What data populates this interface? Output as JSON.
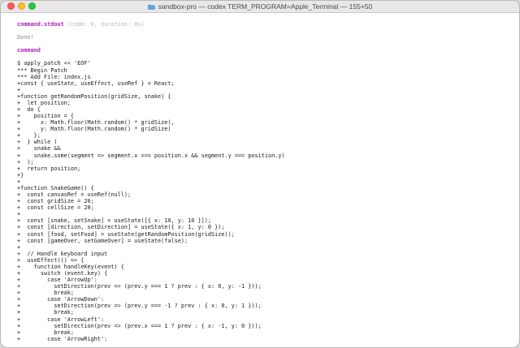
{
  "window": {
    "title": "sandbox-pro — codex TERM_PROGRAM=Apple_Terminal — 155×50",
    "folder_icon": "folder-icon",
    "colors": {
      "command": "#b020c2",
      "meta": "#c9a6d6",
      "dim": "#8a8a8a",
      "text": "#1b1b1b",
      "close": "#ff5f57",
      "minimize": "#febc2e",
      "maximize": "#28c840"
    }
  },
  "terminal": {
    "stdout_label": "command.stdout",
    "stdout_meta": "(code: 0, duration: 0s)",
    "done": "Done!",
    "command_label": "command",
    "lines": [
      "$ apply_patch << 'EOF'",
      "*** Begin Patch",
      "*** Add File: index.js",
      "+const { useState, useEffect, useRef } = React;",
      "+",
      "+function getRandomPosition(gridSize, snake) {",
      "+  let position;",
      "+  do {",
      "+    position = {",
      "+      x: Math.floor(Math.random() * gridSize),",
      "+      y: Math.floor(Math.random() * gridSize)",
      "+    };",
      "+  } while (",
      "+    snake &&",
      "+    snake.some(segment => segment.x === position.x && segment.y === position.y)",
      "+  );",
      "+  return position;",
      "+}",
      "+",
      "+function SnakeGame() {",
      "+  const canvasRef = useRef(null);",
      "+  const gridSize = 20;",
      "+  const cellSize = 20;",
      "+",
      "+  const [snake, setSnake] = useState([{ x: 10, y: 10 }]);",
      "+  const [direction, setDirection] = useState({ x: 1, y: 0 });",
      "+  const [food, setFood] = useState(getRandomPosition(gridSize));",
      "+  const [gameOver, setGameOver] = useState(false);",
      "+",
      "+  // Handle keyboard input",
      "+  useEffect(() => {",
      "+    function handleKey(event) {",
      "+      switch (event.key) {",
      "+        case 'ArrowUp':",
      "+          setDirection(prev => (prev.y === 1 ? prev : { x: 0, y: -1 }));",
      "+          break;",
      "+        case 'ArrowDown':",
      "+          setDirection(prev => (prev.y === -1 ? prev : { x: 0, y: 1 }));",
      "+          break;",
      "+        case 'ArrowLeft':",
      "+          setDirection(prev => (prev.x === 1 ? prev : { x: -1, y: 0 }));",
      "+          break;",
      "+        case 'ArrowRight':"
    ]
  }
}
